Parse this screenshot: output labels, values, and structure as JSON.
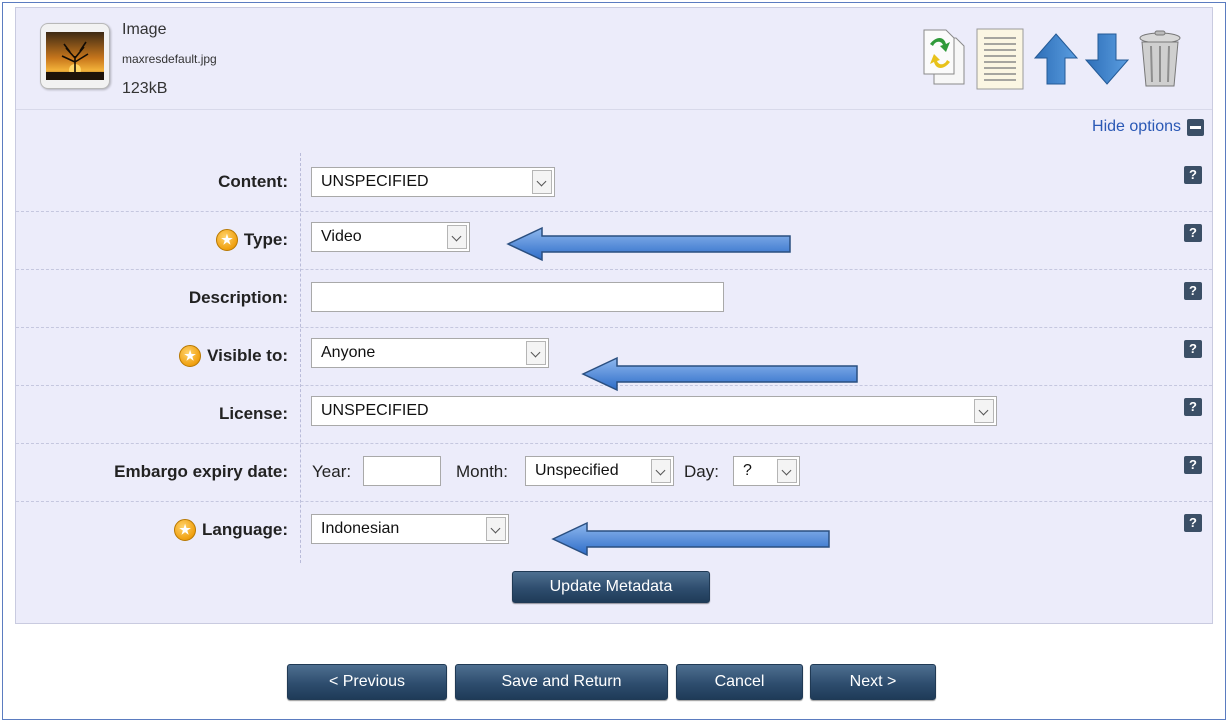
{
  "file": {
    "kind": "Image",
    "name": "maxresdefault.jpg",
    "size": "123kB"
  },
  "toolbar": {
    "icons": [
      "replace-file-icon",
      "view-metadata-icon",
      "move-up-icon",
      "move-down-icon",
      "delete-icon"
    ]
  },
  "hide_options": "Hide options",
  "form": {
    "content": {
      "label": "Content:",
      "value": "UNSPECIFIED"
    },
    "type": {
      "label": "Type:",
      "value": "Video",
      "required": true
    },
    "description": {
      "label": "Description:",
      "value": ""
    },
    "visible_to": {
      "label": "Visible to:",
      "value": "Anyone",
      "required": true
    },
    "license": {
      "label": "License:",
      "value": "UNSPECIFIED"
    },
    "embargo": {
      "label": "Embargo expiry date:",
      "year_label": "Year:",
      "year_value": "",
      "month_label": "Month:",
      "month_value": "Unspecified",
      "day_label": "Day:",
      "day_value": "?"
    },
    "language": {
      "label": "Language:",
      "value": "Indonesian",
      "required": true
    },
    "help_glyph": "?"
  },
  "update_button": "Update Metadata",
  "nav": {
    "previous": "< Previous",
    "save_return": "Save and Return",
    "cancel": "Cancel",
    "next": "Next >"
  },
  "colors": {
    "panel_bg": "#ececfa",
    "link": "#2a58b5",
    "button_dark": "#2e4d6e",
    "callout_arrow": "#3a78d8",
    "star": "#f0a010"
  }
}
